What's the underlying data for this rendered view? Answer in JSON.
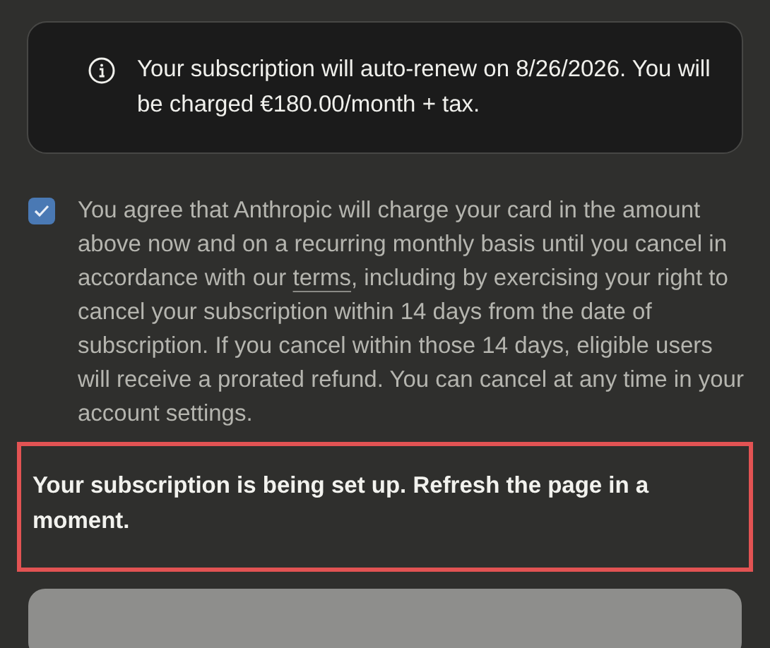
{
  "notice": {
    "text": "Your subscription will auto-renew on 8/26/2026. You will be charged €180.00/month + tax."
  },
  "agreement": {
    "checked": true,
    "text_before": "You agree that Anthropic will charge your card in the amount above now and on a recurring monthly basis until you cancel in accordance with our",
    "link": "terms",
    "text_after": ", including by exercising your right to cancel your subscription within 14 days from the date of subscription. If you cancel within those 14 days, eligible users will receive a prorated refund. You can cancel at any time in your account settings."
  },
  "status_message": {
    "text": "Your subscription is being set up. Refresh the page in a moment.",
    "highlighted": true
  },
  "submit_button": {
    "disabled": true
  }
}
